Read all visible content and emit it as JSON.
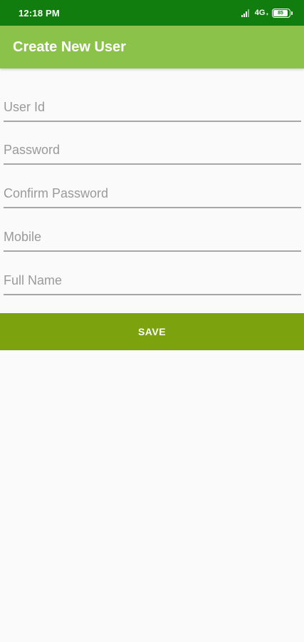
{
  "status_bar": {
    "time": "12:18 PM",
    "network": "4G",
    "network_sub": "+",
    "battery_level": "85",
    "icons": [
      "signal-icon",
      "battery-icon"
    ]
  },
  "app_bar": {
    "title": "Create New User",
    "color": "#8bc34a"
  },
  "form": {
    "fields": [
      {
        "placeholder": "User Id",
        "value": ""
      },
      {
        "placeholder": "Password",
        "value": ""
      },
      {
        "placeholder": "Confirm Password",
        "value": ""
      },
      {
        "placeholder": "Mobile",
        "value": ""
      },
      {
        "placeholder": "Full Name",
        "value": ""
      }
    ],
    "save_label": "SAVE",
    "save_color": "#7ca30d"
  }
}
